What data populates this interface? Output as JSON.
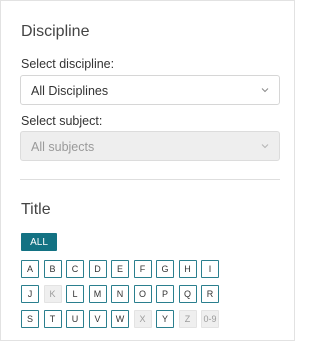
{
  "discipline": {
    "heading": "Discipline",
    "select_discipline_label": "Select discipline:",
    "discipline_value": "All Disciplines",
    "select_subject_label": "Select subject:",
    "subject_value": "All subjects"
  },
  "title_filter": {
    "heading": "Title",
    "all_label": "ALL",
    "rows": [
      [
        {
          "label": "A",
          "enabled": true
        },
        {
          "label": "B",
          "enabled": true
        },
        {
          "label": "C",
          "enabled": true
        },
        {
          "label": "D",
          "enabled": true
        },
        {
          "label": "E",
          "enabled": true
        },
        {
          "label": "F",
          "enabled": true
        },
        {
          "label": "G",
          "enabled": true
        },
        {
          "label": "H",
          "enabled": true
        },
        {
          "label": "I",
          "enabled": true
        }
      ],
      [
        {
          "label": "J",
          "enabled": true
        },
        {
          "label": "K",
          "enabled": false
        },
        {
          "label": "L",
          "enabled": true
        },
        {
          "label": "M",
          "enabled": true
        },
        {
          "label": "N",
          "enabled": true
        },
        {
          "label": "O",
          "enabled": true
        },
        {
          "label": "P",
          "enabled": true
        },
        {
          "label": "Q",
          "enabled": true
        },
        {
          "label": "R",
          "enabled": true
        }
      ],
      [
        {
          "label": "S",
          "enabled": true
        },
        {
          "label": "T",
          "enabled": true
        },
        {
          "label": "U",
          "enabled": true
        },
        {
          "label": "V",
          "enabled": true
        },
        {
          "label": "W",
          "enabled": true
        },
        {
          "label": "X",
          "enabled": false
        },
        {
          "label": "Y",
          "enabled": true
        },
        {
          "label": "Z",
          "enabled": false
        },
        {
          "label": "0-9",
          "enabled": false
        }
      ]
    ]
  },
  "colors": {
    "accent": "#137283",
    "letter_border": "#2a7f8e",
    "disabled_bg": "#efefef"
  }
}
